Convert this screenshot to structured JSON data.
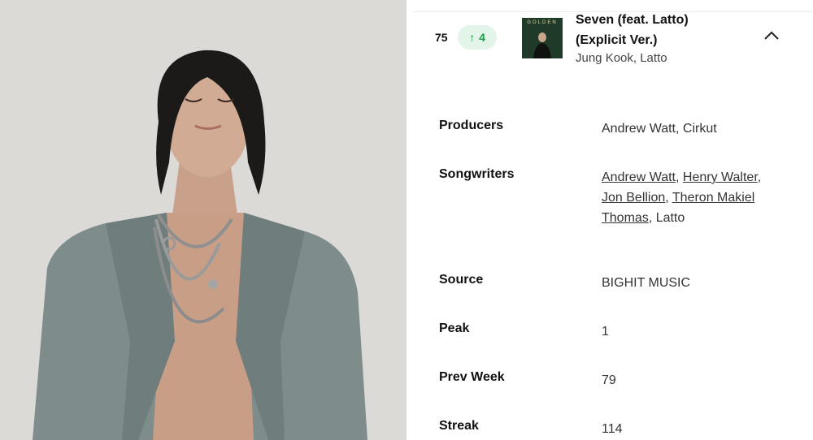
{
  "track": {
    "rank": "75",
    "movement": "4",
    "title": "Seven (feat. Latto) (Explicit Ver.)",
    "artist": "Jung Kook, Latto",
    "cover_text": "GOLDEN"
  },
  "details": {
    "producers": {
      "label": "Producers",
      "value": "Andrew Watt, Cirkut"
    },
    "songwriters": {
      "label": "Songwriters",
      "names": [
        "Andrew Watt",
        "Henry Walter",
        "Jon Bellion",
        "Theron Makiel Thomas",
        "Latto"
      ]
    },
    "source": {
      "label": "Source",
      "value": "BIGHIT MUSIC"
    },
    "peak": {
      "label": "Peak",
      "value": "1"
    },
    "prev_week": {
      "label": "Prev Week",
      "value": "79"
    },
    "streak": {
      "label": "Streak",
      "value": "114"
    }
  },
  "colors": {
    "movement_up": "#1a9b47",
    "movement_badge_bg": "#e3f5e8",
    "jacket": "#7e8c8c"
  },
  "icons": {
    "movement": "arrow-up-icon",
    "collapse": "chevron-up-icon"
  }
}
